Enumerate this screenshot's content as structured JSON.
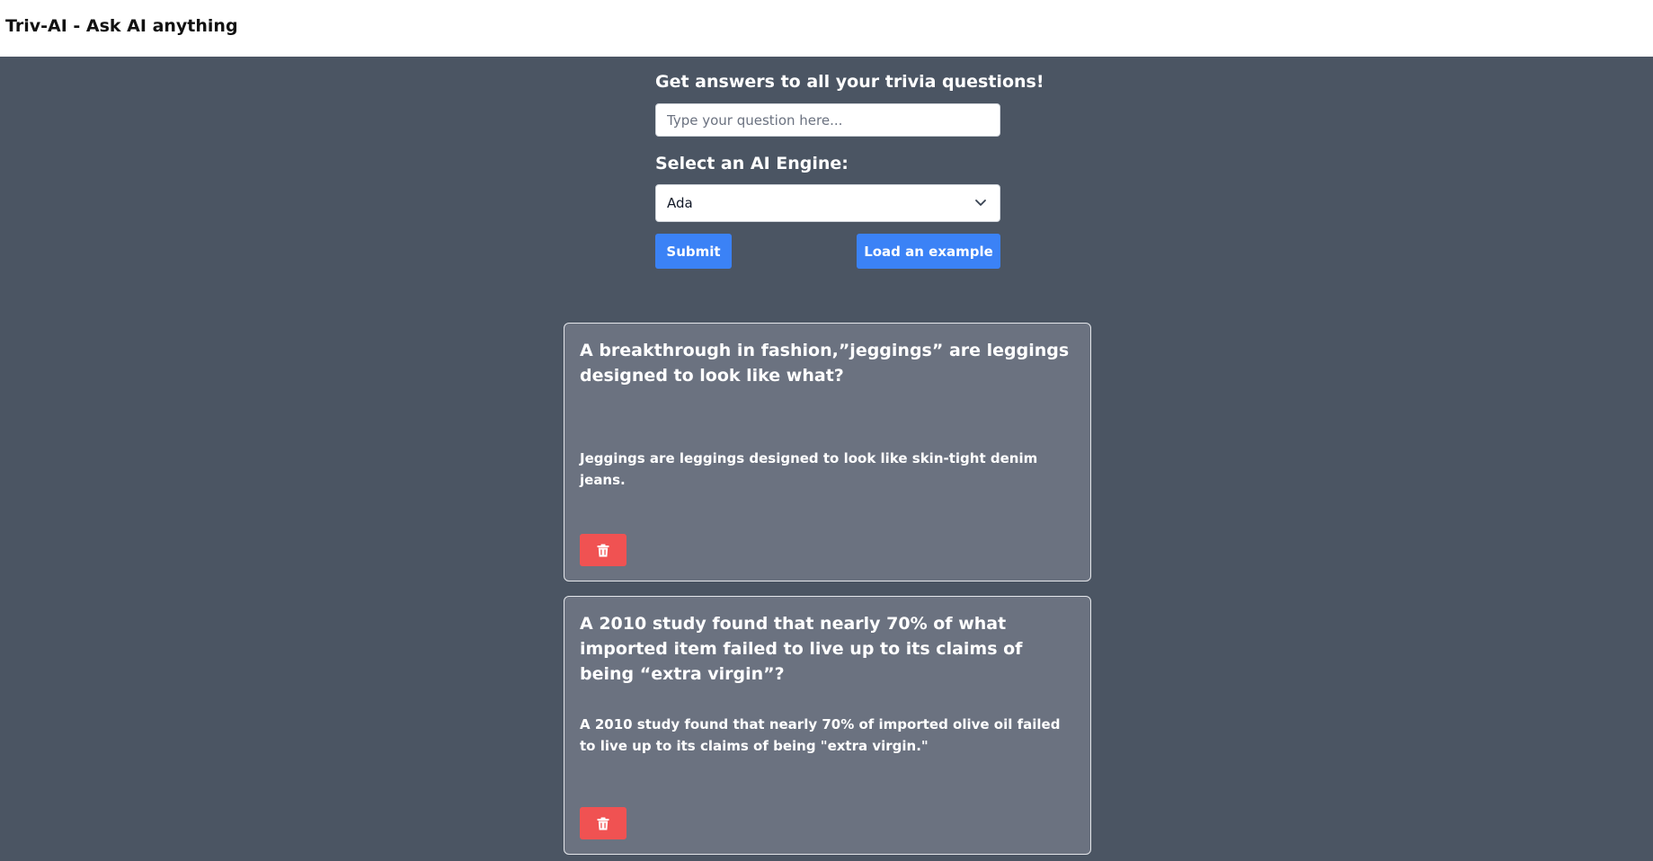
{
  "header": {
    "title": "Triv-AI - Ask AI anything"
  },
  "form": {
    "heading": "Get answers to all your trivia questions!",
    "question_placeholder": "Type your question here...",
    "question_value": "",
    "engine_label": "Select an AI Engine:",
    "engine_selected": "Ada",
    "submit_label": "Submit",
    "example_label": "Load an example"
  },
  "results": [
    {
      "question": "A breakthrough in fashion,”jeggings” are leggings designed to look like what?",
      "answer": "Jeggings are leggings designed to look like skin-tight denim jeans."
    },
    {
      "question": "A 2010 study found that nearly 70% of what imported item failed to live up to its claims of being “extra virgin”?",
      "answer": "A 2010 study found that nearly 70% of imported olive oil failed to live up to its claims of being \"extra virgin.\""
    }
  ],
  "icons": {
    "select_arrow": "chevron-down-icon",
    "delete": "trash-icon"
  },
  "colors": {
    "page_background": "#4b5563",
    "header_background": "#ffffff",
    "card_background": "#6b7280",
    "primary_button": "#3b82f6",
    "delete_button": "#f05252"
  }
}
